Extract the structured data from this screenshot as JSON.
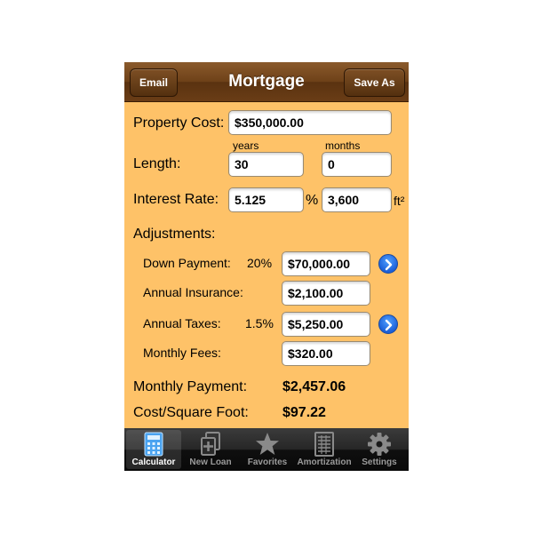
{
  "nav": {
    "title": "Mortgage",
    "left_button": "Email",
    "right_button": "Save As"
  },
  "form": {
    "property_cost": {
      "label": "Property Cost:",
      "value": "$350,000.00"
    },
    "length": {
      "label": "Length:",
      "years_label": "years",
      "months_label": "months",
      "years_value": "30",
      "months_value": "0"
    },
    "interest": {
      "label": "Interest Rate:",
      "rate_value": "5.125",
      "percent_sign": "%",
      "area_value": "3,600",
      "area_unit": "ft²"
    },
    "adjustments": {
      "label": "Adjustments:",
      "down_payment": {
        "label": "Down Payment:",
        "percent": "20%",
        "value": "$70,000.00"
      },
      "annual_insurance": {
        "label": "Annual Insurance:",
        "value": "$2,100.00"
      },
      "annual_taxes": {
        "label": "Annual Taxes:",
        "percent": "1.5%",
        "value": "$5,250.00"
      },
      "monthly_fees": {
        "label": "Monthly Fees:",
        "value": "$320.00"
      }
    }
  },
  "results": {
    "monthly_payment": {
      "label": "Monthly Payment:",
      "value": "$2,457.06"
    },
    "cost_per_sqft": {
      "label": "Cost/Square Foot:",
      "value": "$97.22"
    }
  },
  "tabs": [
    {
      "label": "Calculator",
      "icon": "calculator-icon",
      "selected": true
    },
    {
      "label": "New Loan",
      "icon": "new-loan-icon",
      "selected": false
    },
    {
      "label": "Favorites",
      "icon": "star-icon",
      "selected": false
    },
    {
      "label": "Amortization",
      "icon": "amortization-icon",
      "selected": false
    },
    {
      "label": "Settings",
      "icon": "gear-icon",
      "selected": false
    }
  ],
  "colors": {
    "background": "#fec268",
    "navbar": "#6e4118",
    "accent_blue": "#1b5fd8",
    "tabbar": "#1a1a1a"
  }
}
